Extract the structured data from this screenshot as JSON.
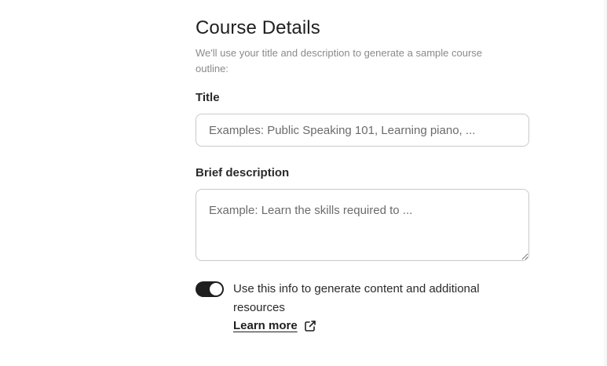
{
  "form": {
    "heading": "Course Details",
    "subtext": "We'll use your title and description to generate a sample course outline:",
    "title_label": "Title",
    "title_placeholder": "Examples: Public Speaking 101, Learning piano, ...",
    "title_value": "",
    "description_label": "Brief description",
    "description_placeholder": "Example: Learn the skills required to ...",
    "description_value": ""
  },
  "toggle": {
    "state": "on",
    "label": "Use this info to generate content and additional resources",
    "learn_more": "Learn more",
    "icon": "external-link-icon"
  },
  "colors": {
    "toggle_on": "#1f1f1f",
    "input_border": "#c9c9c9",
    "subtext": "#8a8a8a"
  }
}
